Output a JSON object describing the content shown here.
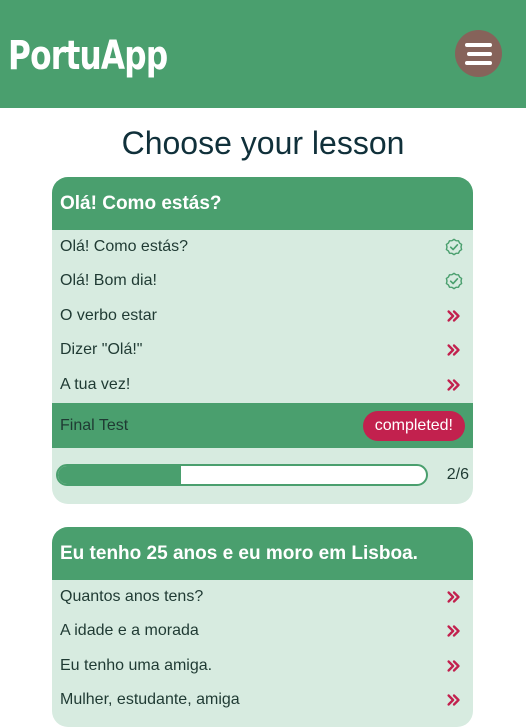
{
  "header": {
    "brand": "PortuApp",
    "menu_icon": "hamburger-menu-icon"
  },
  "page": {
    "title": "Choose your lesson"
  },
  "colors": {
    "header": "#4a9f6e",
    "card_bg": "#d7ebe0",
    "accent_red": "#c2214e",
    "menu_bg": "#86635a"
  },
  "units": [
    {
      "title": "Olá! Como estás?",
      "lessons": [
        {
          "label": "Olá! Como estás?",
          "status_icon": "check-circle-icon"
        },
        {
          "label": "Olá! Bom dia!",
          "status_icon": "check-circle-icon"
        },
        {
          "label": "O verbo estar",
          "status_icon": "double-chevron-right-icon"
        },
        {
          "label": "Dizer \"Olá!\"",
          "status_icon": "double-chevron-right-icon"
        },
        {
          "label": "A tua vez!",
          "status_icon": "double-chevron-right-icon"
        }
      ],
      "final_test": {
        "label": "Final Test",
        "badge": "completed!"
      },
      "progress": {
        "completed": 2,
        "total": 6,
        "text": "2/6"
      }
    },
    {
      "title": "Eu tenho 25 anos e eu moro em Lisboa.",
      "lessons": [
        {
          "label": "Quantos anos tens?",
          "status_icon": "double-chevron-right-icon"
        },
        {
          "label": "A idade e a morada",
          "status_icon": "double-chevron-right-icon"
        },
        {
          "label": "Eu tenho uma amiga.",
          "status_icon": "double-chevron-right-icon"
        },
        {
          "label": "Mulher, estudante, amiga",
          "status_icon": "double-chevron-right-icon"
        }
      ]
    }
  ]
}
